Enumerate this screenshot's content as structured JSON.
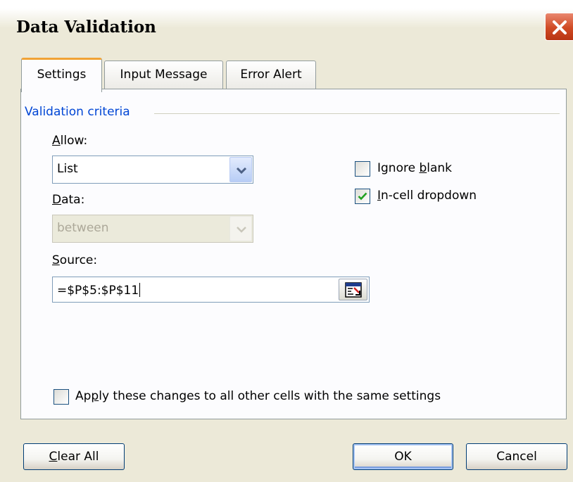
{
  "window": {
    "title": "Data Validation"
  },
  "tabs": [
    {
      "label": "Settings"
    },
    {
      "label": "Input Message"
    },
    {
      "label": "Error Alert"
    }
  ],
  "criteria": {
    "group_label": "Validation criteria",
    "allow": {
      "label_u": "A",
      "label_rest": "llow:",
      "value": "List"
    },
    "data": {
      "label_u": "D",
      "label_rest": "ata:",
      "value": "between"
    },
    "source": {
      "label_u": "S",
      "label_rest": "ource:",
      "value": "=$P$5:$P$11"
    },
    "ignore_blank": {
      "label_pre": "Ignore ",
      "label_u": "b",
      "label_rest": "lank",
      "checked": false
    },
    "incell_dropdown": {
      "label_u": "I",
      "label_rest": "n-cell dropdown",
      "checked": true
    },
    "apply_all": {
      "label_pre": "Ap",
      "label_u": "p",
      "label_rest": "ly these changes to all other cells with the same settings",
      "checked": false
    }
  },
  "buttons": {
    "clear_all_u": "C",
    "clear_all_rest": "lear All",
    "ok": "OK",
    "cancel": "Cancel"
  },
  "colors": {
    "accent_tab": "#f1a336",
    "group_label": "#0046d5",
    "check_mark": "#21a121",
    "close_button": "#d04a24"
  }
}
